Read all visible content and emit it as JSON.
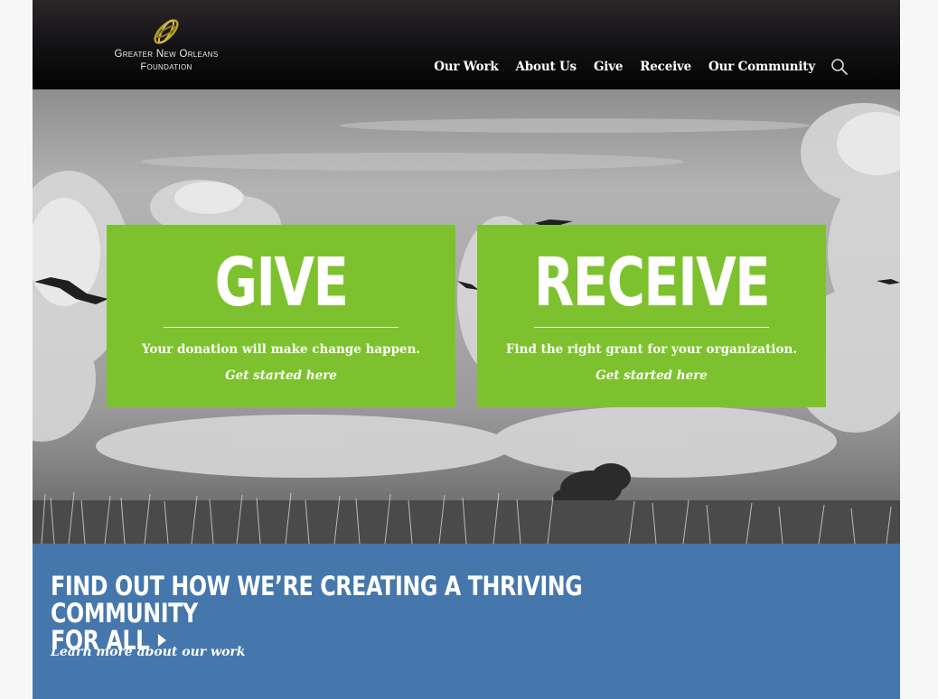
{
  "brand": {
    "line1": "Greater New Orleans",
    "line2": "Foundation",
    "logo_icon": "gold-swirl-logo"
  },
  "nav": {
    "items": [
      {
        "label": "Our Work"
      },
      {
        "label": "About Us"
      },
      {
        "label": "Give"
      },
      {
        "label": "Receive"
      },
      {
        "label": "Our Community"
      }
    ],
    "search_icon": "search-icon"
  },
  "hero": {
    "give": {
      "title": "GIVE",
      "text": "Your donation will make change happen.",
      "link": "Get started here"
    },
    "receive": {
      "title": "RECEIVE",
      "text": "Find the right grant for your organization.",
      "link": "Get started here"
    }
  },
  "banner": {
    "heading_line1": "FIND OUT HOW WE’RE CREATING A THRIVING COMMUNITY",
    "heading_line2": "FOR ALL",
    "link": "Learn more about our work"
  },
  "colors": {
    "accent_green": "#7dc22e",
    "banner_blue": "#4577ad",
    "header_black": "#0b0b0c",
    "logo_gold": "#b7a02c"
  }
}
